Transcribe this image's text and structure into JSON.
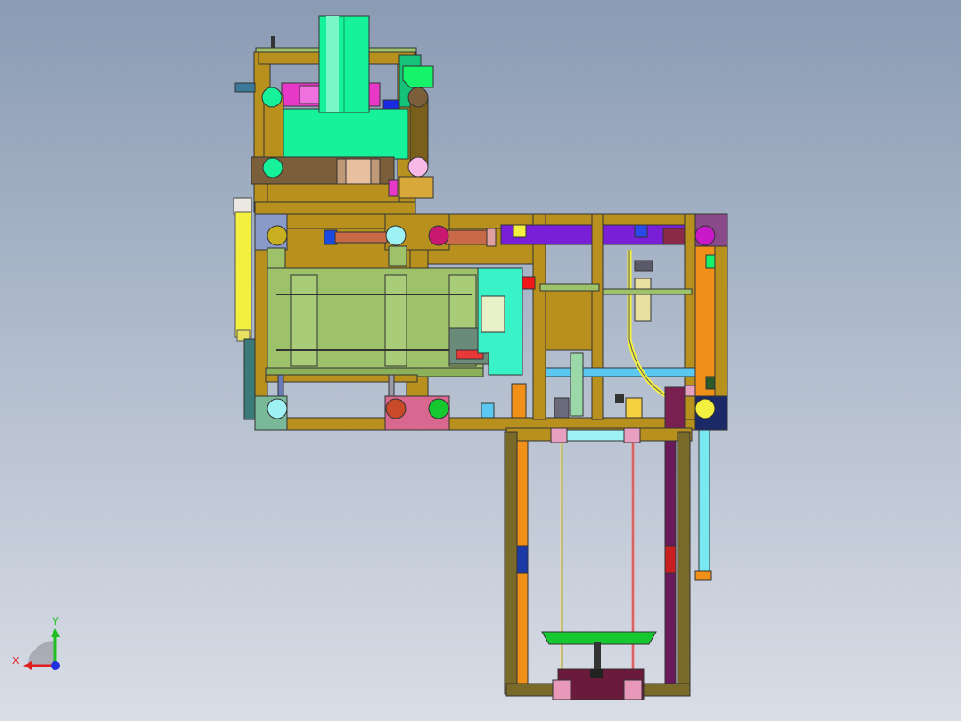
{
  "viewport": {
    "background_top": "#8a9bb4",
    "background_bottom": "#d9dde6"
  },
  "axis_triad": {
    "x_label": "X",
    "y_label": "Y",
    "x_color": "#e02020",
    "y_color": "#20c020",
    "z_color": "#2030e0"
  },
  "palette": {
    "frame": "#b7901e",
    "frame_dark": "#7a5f1a",
    "mint": "#16f29a",
    "green_plate": "#9ec26a",
    "magenta": "#e838c8",
    "purple": "#7a1fd8",
    "orange": "#f09018",
    "yellow": "#f4f040",
    "cyan": "#9ff2f4",
    "navy": "#1b2a66",
    "maroon": "#7a2050",
    "olive": "#7a6a2a"
  }
}
